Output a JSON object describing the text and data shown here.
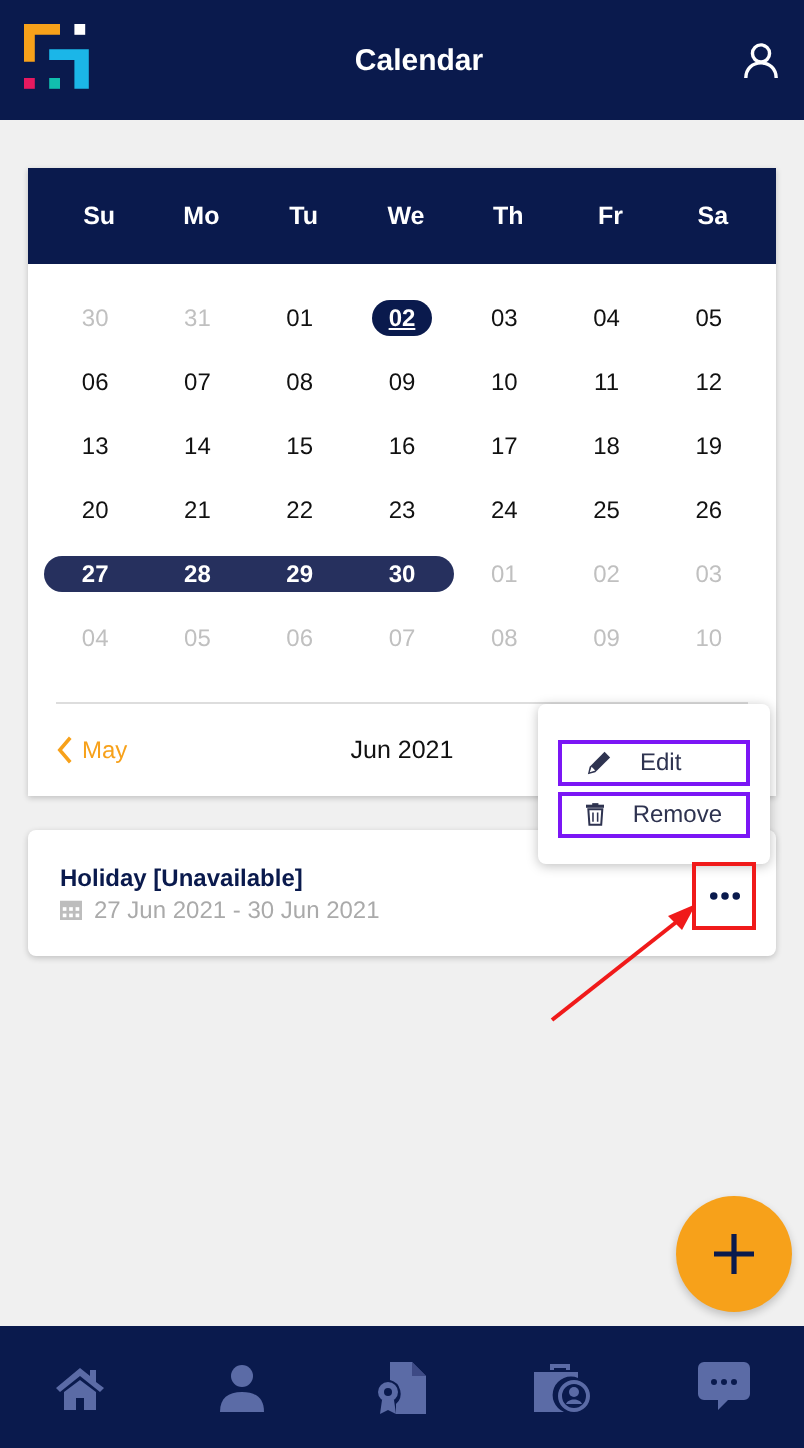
{
  "header": {
    "title": "Calendar"
  },
  "calendar": {
    "weekdays": [
      "Su",
      "Mo",
      "Tu",
      "We",
      "Th",
      "Fr",
      "Sa"
    ],
    "weeks": [
      [
        {
          "day": "30",
          "muted": true,
          "today": false,
          "in_range": false
        },
        {
          "day": "31",
          "muted": true,
          "today": false,
          "in_range": false
        },
        {
          "day": "01",
          "muted": false,
          "today": false,
          "in_range": false
        },
        {
          "day": "02",
          "muted": false,
          "today": true,
          "in_range": false
        },
        {
          "day": "03",
          "muted": false,
          "today": false,
          "in_range": false
        },
        {
          "day": "04",
          "muted": false,
          "today": false,
          "in_range": false
        },
        {
          "day": "05",
          "muted": false,
          "today": false,
          "in_range": false
        }
      ],
      [
        {
          "day": "06",
          "muted": false,
          "today": false,
          "in_range": false
        },
        {
          "day": "07",
          "muted": false,
          "today": false,
          "in_range": false
        },
        {
          "day": "08",
          "muted": false,
          "today": false,
          "in_range": false
        },
        {
          "day": "09",
          "muted": false,
          "today": false,
          "in_range": false
        },
        {
          "day": "10",
          "muted": false,
          "today": false,
          "in_range": false
        },
        {
          "day": "11",
          "muted": false,
          "today": false,
          "in_range": false
        },
        {
          "day": "12",
          "muted": false,
          "today": false,
          "in_range": false
        }
      ],
      [
        {
          "day": "13",
          "muted": false,
          "today": false,
          "in_range": false
        },
        {
          "day": "14",
          "muted": false,
          "today": false,
          "in_range": false
        },
        {
          "day": "15",
          "muted": false,
          "today": false,
          "in_range": false
        },
        {
          "day": "16",
          "muted": false,
          "today": false,
          "in_range": false
        },
        {
          "day": "17",
          "muted": false,
          "today": false,
          "in_range": false
        },
        {
          "day": "18",
          "muted": false,
          "today": false,
          "in_range": false
        },
        {
          "day": "19",
          "muted": false,
          "today": false,
          "in_range": false
        }
      ],
      [
        {
          "day": "20",
          "muted": false,
          "today": false,
          "in_range": false
        },
        {
          "day": "21",
          "muted": false,
          "today": false,
          "in_range": false
        },
        {
          "day": "22",
          "muted": false,
          "today": false,
          "in_range": false
        },
        {
          "day": "23",
          "muted": false,
          "today": false,
          "in_range": false
        },
        {
          "day": "24",
          "muted": false,
          "today": false,
          "in_range": false
        },
        {
          "day": "25",
          "muted": false,
          "today": false,
          "in_range": false
        },
        {
          "day": "26",
          "muted": false,
          "today": false,
          "in_range": false
        }
      ],
      [
        {
          "day": "27",
          "muted": false,
          "today": false,
          "in_range": true
        },
        {
          "day": "28",
          "muted": false,
          "today": false,
          "in_range": true
        },
        {
          "day": "29",
          "muted": false,
          "today": false,
          "in_range": true
        },
        {
          "day": "30",
          "muted": false,
          "today": false,
          "in_range": true
        },
        {
          "day": "01",
          "muted": true,
          "today": false,
          "in_range": false
        },
        {
          "day": "02",
          "muted": true,
          "today": false,
          "in_range": false
        },
        {
          "day": "03",
          "muted": true,
          "today": false,
          "in_range": false
        }
      ],
      [
        {
          "day": "04",
          "muted": true,
          "today": false,
          "in_range": false
        },
        {
          "day": "05",
          "muted": true,
          "today": false,
          "in_range": false
        },
        {
          "day": "06",
          "muted": true,
          "today": false,
          "in_range": false
        },
        {
          "day": "07",
          "muted": true,
          "today": false,
          "in_range": false
        },
        {
          "day": "08",
          "muted": true,
          "today": false,
          "in_range": false
        },
        {
          "day": "09",
          "muted": true,
          "today": false,
          "in_range": false
        },
        {
          "day": "10",
          "muted": true,
          "today": false,
          "in_range": false
        }
      ]
    ],
    "prev_month": "May",
    "current_month": "Jun 2021"
  },
  "event": {
    "title": "Holiday [Unavailable]",
    "dates": "27 Jun 2021 - 30 Jun 2021",
    "more_highlighted": true
  },
  "menu": {
    "items": [
      {
        "kind": "edit",
        "label": "Edit",
        "highlighted": true
      },
      {
        "kind": "remove",
        "label": "Remove",
        "highlighted": true
      }
    ]
  },
  "nav": {
    "items": [
      {
        "kind": "home"
      },
      {
        "kind": "person"
      },
      {
        "kind": "certificate"
      },
      {
        "kind": "briefcase"
      },
      {
        "kind": "chat"
      }
    ]
  }
}
